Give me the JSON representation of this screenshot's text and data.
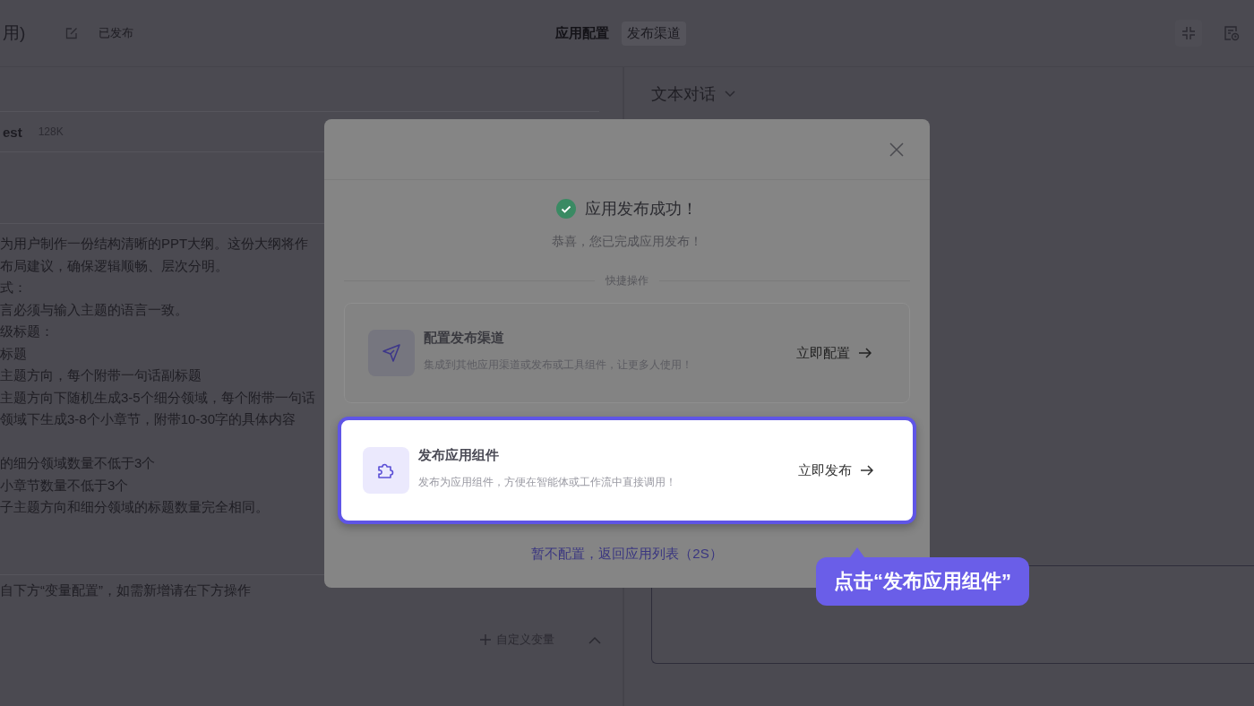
{
  "header": {
    "title": "用)",
    "status": "已发布",
    "tabs": [
      {
        "label": "应用配置",
        "selected": true
      },
      {
        "label": "发布渠道",
        "selected": false
      }
    ]
  },
  "model": {
    "name": "est",
    "context": "128K"
  },
  "prompt_paragraphs": [
    {
      "lines": [
        "为用户制作一份结构清晰的PPT大纲。这份大纲将作",
        "布局建议，确保逻辑顺畅、层次分明。",
        "式：",
        "言必须与输入主题的语言一致。",
        "级标题：",
        "标题",
        "主题方向，每个附带一句话副标题",
        "主题方向下随机生成3-5个细分领域，每个附带一句话",
        "领域下生成3-8个小章节，附带10-30字的具体内容"
      ]
    },
    {
      "lines": [
        "的细分领域数量不低于3个",
        "小章节数量不低于3个",
        "子主题方向和细分领域的标题数量完全相同。"
      ]
    }
  ],
  "variables": {
    "hint": "自下方“变量配置”，如需新增请在下方操作",
    "add_button": "自定义变量"
  },
  "chat": {
    "mode": "文本对话"
  },
  "modal": {
    "title": "应用发布成功！",
    "subtitle": "恭喜，您已完成应用发布！",
    "section": "快捷操作",
    "actions": [
      {
        "kind": "channel",
        "title": "配置发布渠道",
        "description": "集成到其他应用渠道或发布或工具组件，让更多人使用！",
        "button": "立即配置",
        "highlighted": false
      },
      {
        "kind": "component",
        "title": "发布应用组件",
        "description": "发布为应用组件，方便在智能体或工作流中直接调用！",
        "button": "立即发布",
        "highlighted": true
      }
    ],
    "back_link": "暂不配置，返回应用列表（2S）"
  },
  "guide": {
    "text": "点击“发布应用组件”"
  }
}
